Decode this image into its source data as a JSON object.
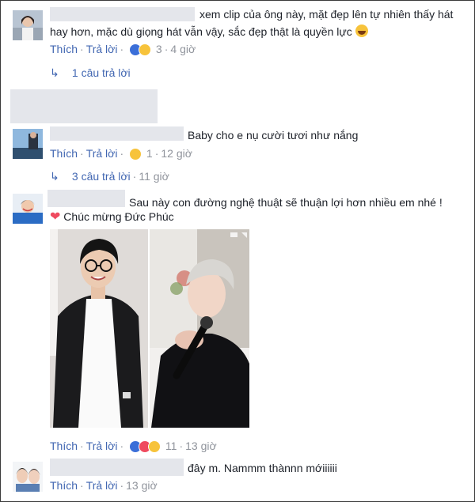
{
  "comments": [
    {
      "text_line1": "xem clip của ông này, mặt đẹp lên tự nhiên thấy hát",
      "text_line2": "hay hơn, mặc dù giọng hát vẫn vậy, sắc đẹp thật là quyền lực",
      "emoji": "😆",
      "like": "Thích",
      "reply": "Trả lời",
      "reaction_count": "3",
      "time": "4 giờ",
      "replies": "1 câu trả lời"
    },
    {
      "text": "Baby cho e nụ cười tươi như nắng",
      "like": "Thích",
      "reply": "Trả lời",
      "reaction_count": "1",
      "time": "12 giờ",
      "replies": "3 câu trả lời",
      "replies_time": "11 giờ"
    },
    {
      "text_line1": "Sau này con đường nghệ thuật sẽ thuận lợi hơn nhiều em nhé !",
      "text_line2": "Chúc mừng Đức Phúc",
      "heart": "❤",
      "like": "Thích",
      "reply": "Trả lời",
      "reaction_count": "11",
      "time": "13 giờ"
    },
    {
      "text": "đây m. Nammm thànnn mớiiiiii",
      "like": "Thích",
      "reply": "Trả lời",
      "time": "13 giờ"
    }
  ],
  "icons": {
    "reply_arrow": "↳"
  },
  "colors": {
    "link": "#4267b2",
    "meta": "#90949c",
    "like_reaction": "#3b6fd8",
    "haha_reaction": "#f7c33b",
    "love_reaction": "#ef4a5f"
  }
}
